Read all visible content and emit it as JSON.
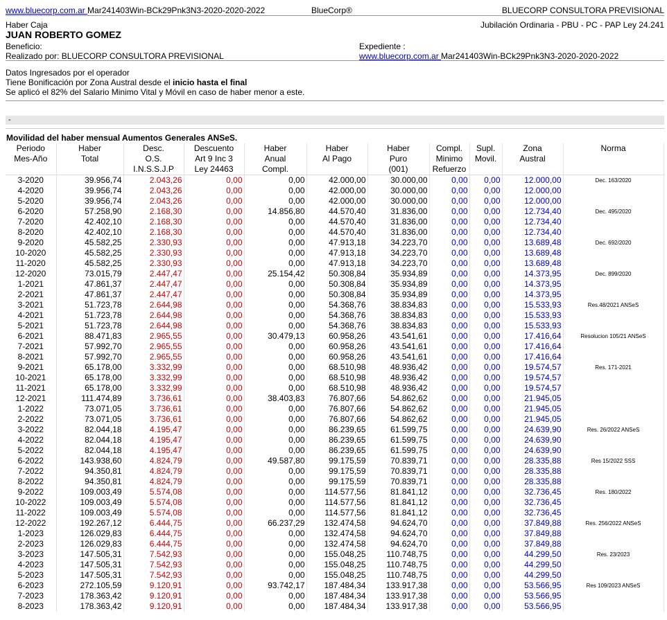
{
  "top": {
    "link_text": "www.bluecorp.com.ar ",
    "link_code": "Mar241403Win-BCk29Pnk3N3-2020-2020-2022",
    "brand": "BlueCorp®",
    "company": "BLUECORP CONSULTORA PREVISIONAL"
  },
  "header": {
    "haber_caja": "Haber Caja",
    "regime": "Jubilación Ordinaria - PBU - PC - PAP Ley 24.241",
    "name": "JUAN ROBERTO GOMEZ",
    "beneficio": "Beneficio:",
    "expediente": "Expediente :",
    "realizado": "Realizado por: BLUECORP CONSULTORA PREVISIONAL",
    "exp_link": "www.bluecorp.com.ar ",
    "exp_code": "Mar241403Win-BCk29Pnk3N3-2020-2020-2022"
  },
  "info": {
    "line1": "Datos Ingresados por el operador",
    "line2_pre": "Tiene Bonificación por Zona Austral desde el ",
    "line2_bold": "inicio hasta el final",
    "line3": "Se aplicó el 82% del Salario Minimo Vital y Móvil en caso de haber menor a este."
  },
  "band_text": "-",
  "table": {
    "title": "Movilidad del haber mensual Aumentos Generales ANSeS.",
    "headers": [
      [
        "Periodo",
        "Mes-Año",
        ""
      ],
      [
        "Haber",
        "Total",
        ""
      ],
      [
        "Desc.",
        "O.S.",
        "I.N.S.S.J.P"
      ],
      [
        "Descuento",
        "Art 9 Inc 3",
        "Ley 24463"
      ],
      [
        "Haber",
        "Anual",
        "Compl."
      ],
      [
        "Haber",
        "Al Pago",
        ""
      ],
      [
        "Haber",
        "Puro",
        "(001)"
      ],
      [
        "Compl.",
        "Minimo",
        "Refuerzo"
      ],
      [
        "Supl.",
        "Movil.",
        ""
      ],
      [
        "Zona",
        "Austral",
        ""
      ],
      [
        "Norma",
        "",
        ""
      ]
    ],
    "rows": [
      [
        "3-2020",
        "39.956,74",
        "2.043,26",
        "0,00",
        "0,00",
        "42.000,00",
        "30.000,00",
        "0,00",
        "0,00",
        "12.000,00",
        "Dec. 163/2020"
      ],
      [
        "4-2020",
        "39.956,74",
        "2.043,26",
        "0,00",
        "0,00",
        "42.000,00",
        "30.000,00",
        "0,00",
        "0,00",
        "12.000,00",
        ""
      ],
      [
        "5-2020",
        "39.956,74",
        "2.043,26",
        "0,00",
        "0,00",
        "42.000,00",
        "30.000,00",
        "0,00",
        "0,00",
        "12.000,00",
        ""
      ],
      [
        "6-2020",
        "57.258,90",
        "2.168,30",
        "0,00",
        "14.856,80",
        "44.570,40",
        "31.836,00",
        "0,00",
        "0,00",
        "12.734,40",
        "Dec. 495/2020"
      ],
      [
        "7-2020",
        "42.402,10",
        "2.168,30",
        "0,00",
        "0,00",
        "44.570,40",
        "31.836,00",
        "0,00",
        "0,00",
        "12.734,40",
        ""
      ],
      [
        "8-2020",
        "42.402,10",
        "2.168,30",
        "0,00",
        "0,00",
        "44.570,40",
        "31.836,00",
        "0,00",
        "0,00",
        "12.734,40",
        ""
      ],
      [
        "9-2020",
        "45.582,25",
        "2.330,93",
        "0,00",
        "0,00",
        "47.913,18",
        "34.223,70",
        "0,00",
        "0,00",
        "13.689,48",
        "Dec. 692/2020"
      ],
      [
        "10-2020",
        "45.582,25",
        "2.330,93",
        "0,00",
        "0,00",
        "47.913,18",
        "34.223,70",
        "0,00",
        "0,00",
        "13.689,48",
        ""
      ],
      [
        "11-2020",
        "45.582,25",
        "2.330,93",
        "0,00",
        "0,00",
        "47.913,18",
        "34.223,70",
        "0,00",
        "0,00",
        "13.689,48",
        ""
      ],
      [
        "12-2020",
        "73.015,79",
        "2.447,47",
        "0,00",
        "25.154,42",
        "50.308,84",
        "35.934,89",
        "0,00",
        "0,00",
        "14.373,95",
        "Dec. 899/2020"
      ],
      [
        "1-2021",
        "47.861,37",
        "2.447,47",
        "0,00",
        "0,00",
        "50.308,84",
        "35.934,89",
        "0,00",
        "0,00",
        "14.373,95",
        ""
      ],
      [
        "2-2021",
        "47.861,37",
        "2.447,47",
        "0,00",
        "0,00",
        "50.308,84",
        "35.934,89",
        "0,00",
        "0,00",
        "14.373,95",
        ""
      ],
      [
        "3-2021",
        "51.723,78",
        "2.644,98",
        "0,00",
        "0,00",
        "54.368,76",
        "38.834,83",
        "0,00",
        "0,00",
        "15.533,93",
        "Res.48/2021 ANSeS"
      ],
      [
        "4-2021",
        "51.723,78",
        "2.644,98",
        "0,00",
        "0,00",
        "54.368,76",
        "38.834,83",
        "0,00",
        "0,00",
        "15.533,93",
        ""
      ],
      [
        "5-2021",
        "51.723,78",
        "2.644,98",
        "0,00",
        "0,00",
        "54.368,76",
        "38.834,83",
        "0,00",
        "0,00",
        "15.533,93",
        ""
      ],
      [
        "6-2021",
        "88.471,83",
        "2.965,55",
        "0,00",
        "30.479,13",
        "60.958,26",
        "43.541,61",
        "0,00",
        "0,00",
        "17.416,64",
        "Resolucion 105/21 ANSeS"
      ],
      [
        "7-2021",
        "57.992,70",
        "2.965,55",
        "0,00",
        "0,00",
        "60.958,26",
        "43.541,61",
        "0,00",
        "0,00",
        "17.416,64",
        ""
      ],
      [
        "8-2021",
        "57.992,70",
        "2.965,55",
        "0,00",
        "0,00",
        "60.958,26",
        "43.541,61",
        "0,00",
        "0,00",
        "17.416,64",
        ""
      ],
      [
        "9-2021",
        "65.178,00",
        "3.332,99",
        "0,00",
        "0,00",
        "68.510,98",
        "48.936,42",
        "0,00",
        "0,00",
        "19.574,57",
        "Res. 171-2021"
      ],
      [
        "10-2021",
        "65.178,00",
        "3.332,99",
        "0,00",
        "0,00",
        "68.510,98",
        "48.936,42",
        "0,00",
        "0,00",
        "19.574,57",
        ""
      ],
      [
        "11-2021",
        "65.178,00",
        "3.332,99",
        "0,00",
        "0,00",
        "68.510,98",
        "48.936,42",
        "0,00",
        "0,00",
        "19.574,57",
        ""
      ],
      [
        "12-2021",
        "111.474,89",
        "3.736,61",
        "0,00",
        "38.403,83",
        "76.807,66",
        "54.862,62",
        "0,00",
        "0,00",
        "21.945,05",
        ""
      ],
      [
        "1-2022",
        "73.071,05",
        "3.736,61",
        "0,00",
        "0,00",
        "76.807,66",
        "54.862,62",
        "0,00",
        "0,00",
        "21.945,05",
        ""
      ],
      [
        "2-2022",
        "73.071,05",
        "3.736,61",
        "0,00",
        "0,00",
        "76.807,66",
        "54.862,62",
        "0,00",
        "0,00",
        "21.945,05",
        ""
      ],
      [
        "3-2022",
        "82.044,18",
        "4.195,47",
        "0,00",
        "0,00",
        "86.239,65",
        "61.599,75",
        "0,00",
        "0,00",
        "24.639,90",
        "Res. 26/2022 ANSeS"
      ],
      [
        "4-2022",
        "82.044,18",
        "4.195,47",
        "0,00",
        "0,00",
        "86.239,65",
        "61.599,75",
        "0,00",
        "0,00",
        "24.639,90",
        ""
      ],
      [
        "5-2022",
        "82.044,18",
        "4.195,47",
        "0,00",
        "0,00",
        "86.239,65",
        "61.599,75",
        "0,00",
        "0,00",
        "24.639,90",
        ""
      ],
      [
        "6-2022",
        "143.938,60",
        "4.824,79",
        "0,00",
        "49.587,80",
        "99.175,59",
        "70.839,71",
        "0,00",
        "0,00",
        "28.335,88",
        "Res 15/2022 SSS"
      ],
      [
        "7-2022",
        "94.350,81",
        "4.824,79",
        "0,00",
        "0,00",
        "99.175,59",
        "70.839,71",
        "0,00",
        "0,00",
        "28.335,88",
        ""
      ],
      [
        "8-2022",
        "94.350,81",
        "4.824,79",
        "0,00",
        "0,00",
        "99.175,59",
        "70.839,71",
        "0,00",
        "0,00",
        "28.335,88",
        ""
      ],
      [
        "9-2022",
        "109.003,49",
        "5.574,08",
        "0,00",
        "0,00",
        "114.577,56",
        "81.841,12",
        "0,00",
        "0,00",
        "32.736,45",
        "Res. 180/2022"
      ],
      [
        "10-2022",
        "109.003,49",
        "5.574,08",
        "0,00",
        "0,00",
        "114.577,56",
        "81.841,12",
        "0,00",
        "0,00",
        "32.736,45",
        ""
      ],
      [
        "11-2022",
        "109.003,49",
        "5.574,08",
        "0,00",
        "0,00",
        "114.577,56",
        "81.841,12",
        "0,00",
        "0,00",
        "32.736,45",
        ""
      ],
      [
        "12-2022",
        "192.267,12",
        "6.444,75",
        "0,00",
        "66.237,29",
        "132.474,58",
        "94.624,70",
        "0,00",
        "0,00",
        "37.849,88",
        "Res. 256/2022 ANSeS"
      ],
      [
        "1-2023",
        "126.029,83",
        "6.444,75",
        "0,00",
        "0,00",
        "132.474,58",
        "94.624,70",
        "0,00",
        "0,00",
        "37.849,88",
        ""
      ],
      [
        "2-2023",
        "126.029,83",
        "6.444,75",
        "0,00",
        "0,00",
        "132.474,58",
        "94.624,70",
        "0,00",
        "0,00",
        "37.849,88",
        ""
      ],
      [
        "3-2023",
        "147.505,31",
        "7.542,93",
        "0,00",
        "0,00",
        "155.048,25",
        "110.748,75",
        "0,00",
        "0,00",
        "44.299,50",
        "Res. 23/2023"
      ],
      [
        "4-2023",
        "147.505,31",
        "7.542,93",
        "0,00",
        "0,00",
        "155.048,25",
        "110.748,75",
        "0,00",
        "0,00",
        "44.299,50",
        ""
      ],
      [
        "5-2023",
        "147.505,31",
        "7.542,93",
        "0,00",
        "0,00",
        "155.048,25",
        "110.748,75",
        "0,00",
        "0,00",
        "44.299,50",
        ""
      ],
      [
        "6-2023",
        "272.105,59",
        "9.120,91",
        "0,00",
        "93.742,17",
        "187.484,34",
        "133.917,38",
        "0,00",
        "0,00",
        "53.566,95",
        "Res 109/2023 ANSeS"
      ],
      [
        "7-2023",
        "178.363,42",
        "9.120,91",
        "0,00",
        "0,00",
        "187.484,34",
        "133.917,38",
        "0,00",
        "0,00",
        "53.566,95",
        ""
      ],
      [
        "8-2023",
        "178.363,42",
        "9.120,91",
        "0,00",
        "0,00",
        "187.484,34",
        "133.917,38",
        "0,00",
        "0,00",
        "53.566,95",
        ""
      ]
    ]
  },
  "colors": {
    "link": "#0000cc",
    "desc": "#cc0000",
    "blue_values": "#0000cc"
  }
}
